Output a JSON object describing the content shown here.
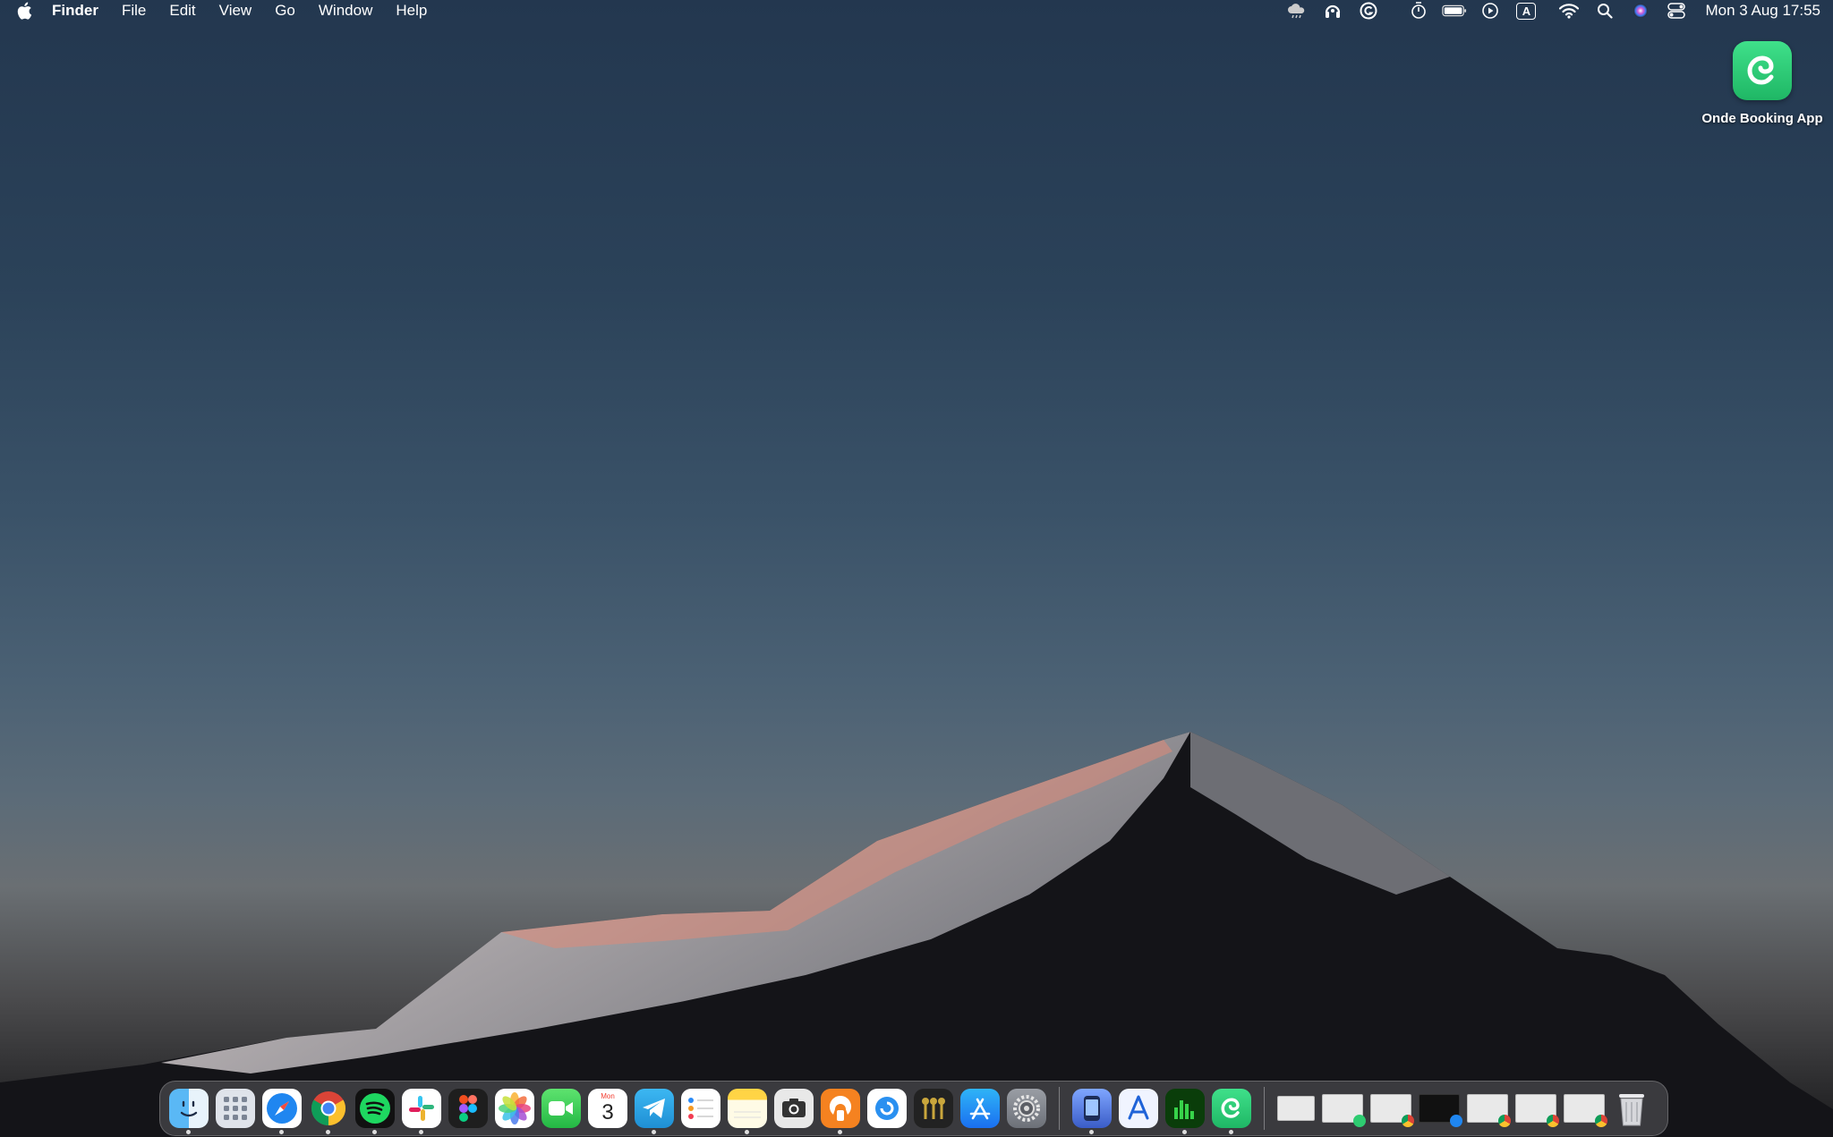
{
  "menubar": {
    "app_name": "Finder",
    "items": [
      "File",
      "Edit",
      "View",
      "Go",
      "Window",
      "Help"
    ],
    "status_icons": [
      "cloud-rain-icon",
      "headphones-icon",
      "grammarly-icon",
      "timer-icon",
      "battery-icon",
      "play-icon",
      "input-source-icon",
      "wifi-icon",
      "search-icon",
      "siri-icon",
      "control-center-icon"
    ],
    "input_source_label": "A",
    "clock": "Mon 3 Aug  17:55"
  },
  "desktop": {
    "icon_label": "Onde Booking App",
    "accent": "#2ecc71"
  },
  "dock": {
    "calendar_month": "Mon",
    "calendar_day": "3",
    "apps": [
      "finder-icon",
      "launchpad-icon",
      "safari-icon",
      "chrome-icon",
      "spotify-icon",
      "slack-icon",
      "figma-icon",
      "photos-icon",
      "facetime-icon",
      "calendar-icon",
      "telegram-icon",
      "reminders-icon",
      "notes-icon",
      "screenshot-icon",
      "vpn-icon",
      "bluetooth-app-icon",
      "keychain-icon",
      "app-store-icon",
      "system-preferences-icon",
      "xcode-simulator-icon",
      "instruments-icon",
      "activity-monitor-icon",
      "onde-booking-icon"
    ],
    "minimized_windows": 7,
    "trash": "trash-icon"
  }
}
